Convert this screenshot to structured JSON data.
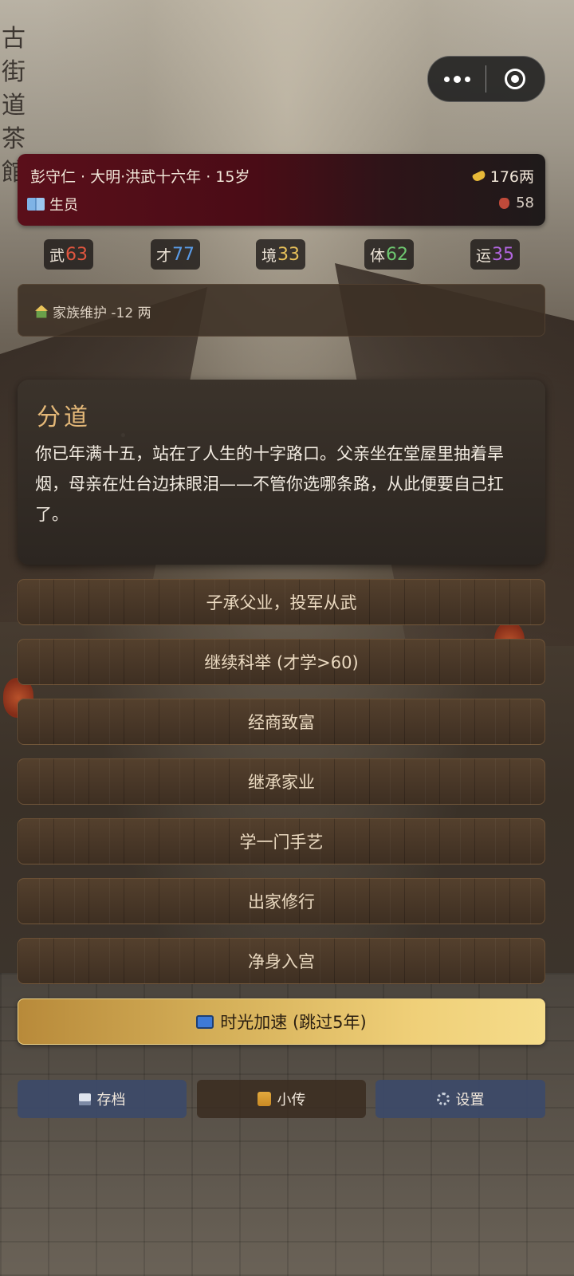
{
  "menu_capsule": {
    "more_icon": "more-dots-icon",
    "close_icon": "target-circle-icon"
  },
  "background_sign": [
    "古",
    "街",
    "道",
    "茶",
    "館"
  ],
  "header": {
    "character_line": "彭守仁 · 大明·洪武十六年 · 15岁",
    "status": "生员",
    "money": "176两",
    "health": "58",
    "colors": {
      "card": "#5a0f1a"
    }
  },
  "stats": [
    {
      "label": "武",
      "value": "63",
      "color": "#e0563f"
    },
    {
      "label": "才",
      "value": "77",
      "color": "#5a9ce8"
    },
    {
      "label": "境",
      "value": "33",
      "color": "#e7c15a"
    },
    {
      "label": "体",
      "value": "62",
      "color": "#6ec770"
    },
    {
      "label": "运",
      "value": "35",
      "color": "#b266e0"
    }
  ],
  "upkeep": {
    "text": "家族维护 -12 两"
  },
  "story": {
    "title": "分道",
    "body": "你已年满十五，站在了人生的十字路口。父亲坐在堂屋里抽着旱烟，母亲在灶台边抹眼泪——不管你选哪条路，从此便要自己扛了。"
  },
  "options": [
    {
      "label": "子承父业，投军从武"
    },
    {
      "label": "继续科举 (才学>60)"
    },
    {
      "label": "经商致富"
    },
    {
      "label": "继承家业"
    },
    {
      "label": "学一门手艺"
    },
    {
      "label": "出家修行"
    },
    {
      "label": "净身入宫"
    }
  ],
  "time_skip": {
    "label": "时光加速 (跳过5年)"
  },
  "bottom_bar": {
    "save": "存档",
    "bio": "小传",
    "settings": "设置"
  }
}
